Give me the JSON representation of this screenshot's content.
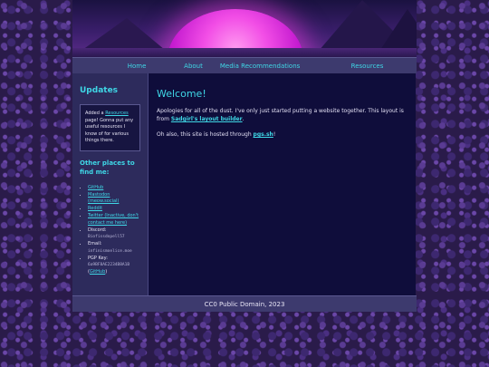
{
  "nav": {
    "items": [
      "Home",
      "About",
      "Media Recommendations",
      "Resources"
    ]
  },
  "sidebar": {
    "updates_title": "Updates",
    "update_prefix": "Added a ",
    "update_link": "Resources",
    "update_suffix": " page! Gonna put any useful resources I know of for various things there.",
    "places_title": "Other places to find me:",
    "places": {
      "github": "GitHub",
      "mastodon": "Mastodon (meow.social)",
      "reddit": "Reddit",
      "twitter": "Twitter (Inactive, don't contact me here)",
      "discord_label": "Discord:",
      "discord_value": "Biofissdopell57",
      "email_label": "Email:",
      "email_value": "infinismoelice.moe",
      "pgp_label": "PGP Key:",
      "pgp_value": "6a9BF8AE2234B8A1B",
      "pgp_link": "GitHub"
    }
  },
  "content": {
    "title": "Welcome!",
    "p1_text": "Apologies for all of the dust. I've only just started putting a website together. This layout is from ",
    "p1_link": "Sadgirl's layout builder",
    "p1_end": ".",
    "p2_text": "Oh also, this site is hosted through ",
    "p2_link": "pgs.sh",
    "p2_end": "!"
  },
  "footer": {
    "text": "CC0 Public Domain, 2023"
  }
}
